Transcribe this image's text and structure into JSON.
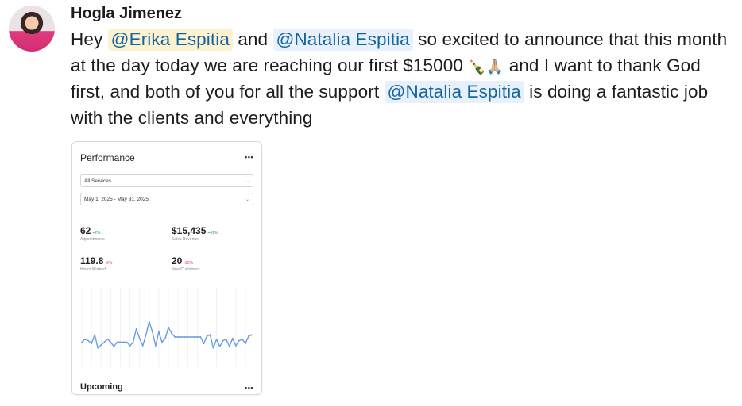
{
  "message": {
    "author": "Hogla Jimenez",
    "text": {
      "part1": "Hey ",
      "mention1": "@Erika Espitia",
      "part2": " and ",
      "mention2": "@Natalia Espitia",
      "part3": " so excited to announce that this month at the day today we are reaching our first $15000 ",
      "emoji": "🍾🙏🏼",
      "part4": " and I want to thank God first, and both of you for all the support ",
      "mention3": "@Natalia Espitia",
      "part5": " is doing a fantastic job with the clients and everything"
    }
  },
  "attachment": {
    "title": "Performance",
    "menu": "•••",
    "service_filter": "All Services",
    "date_range": "May 1, 2025 - May 31, 2025",
    "metrics": [
      {
        "value": "62",
        "change": "+2%",
        "label": "Appointments",
        "trend": "up"
      },
      {
        "value": "$15,435",
        "change": "+41%",
        "label": "Sales Revenue",
        "trend": "up"
      },
      {
        "value": "119.8",
        "change": "-9%",
        "label": "Hours Worked",
        "trend": "down"
      },
      {
        "value": "20",
        "change": "-23%",
        "label": "New Customers",
        "trend": "down"
      }
    ],
    "chart_data": {
      "type": "line",
      "series": [
        {
          "values": [
            30,
            34,
            32,
            28,
            40,
            22,
            26,
            30,
            34,
            30,
            24,
            30,
            30,
            30,
            30,
            25,
            30,
            48,
            35,
            25,
            40,
            58,
            44,
            25,
            44,
            30,
            35,
            50,
            42,
            37,
            37,
            37,
            37,
            37,
            37,
            37,
            37,
            37,
            28,
            38,
            40,
            22,
            34,
            24,
            32,
            34,
            24,
            35,
            25,
            32,
            34,
            28,
            38,
            40
          ]
        }
      ],
      "ylim": [
        0,
        100
      ],
      "line_color": "#6a9be8",
      "grid": false
    },
    "upcoming_title": "Upcoming"
  }
}
